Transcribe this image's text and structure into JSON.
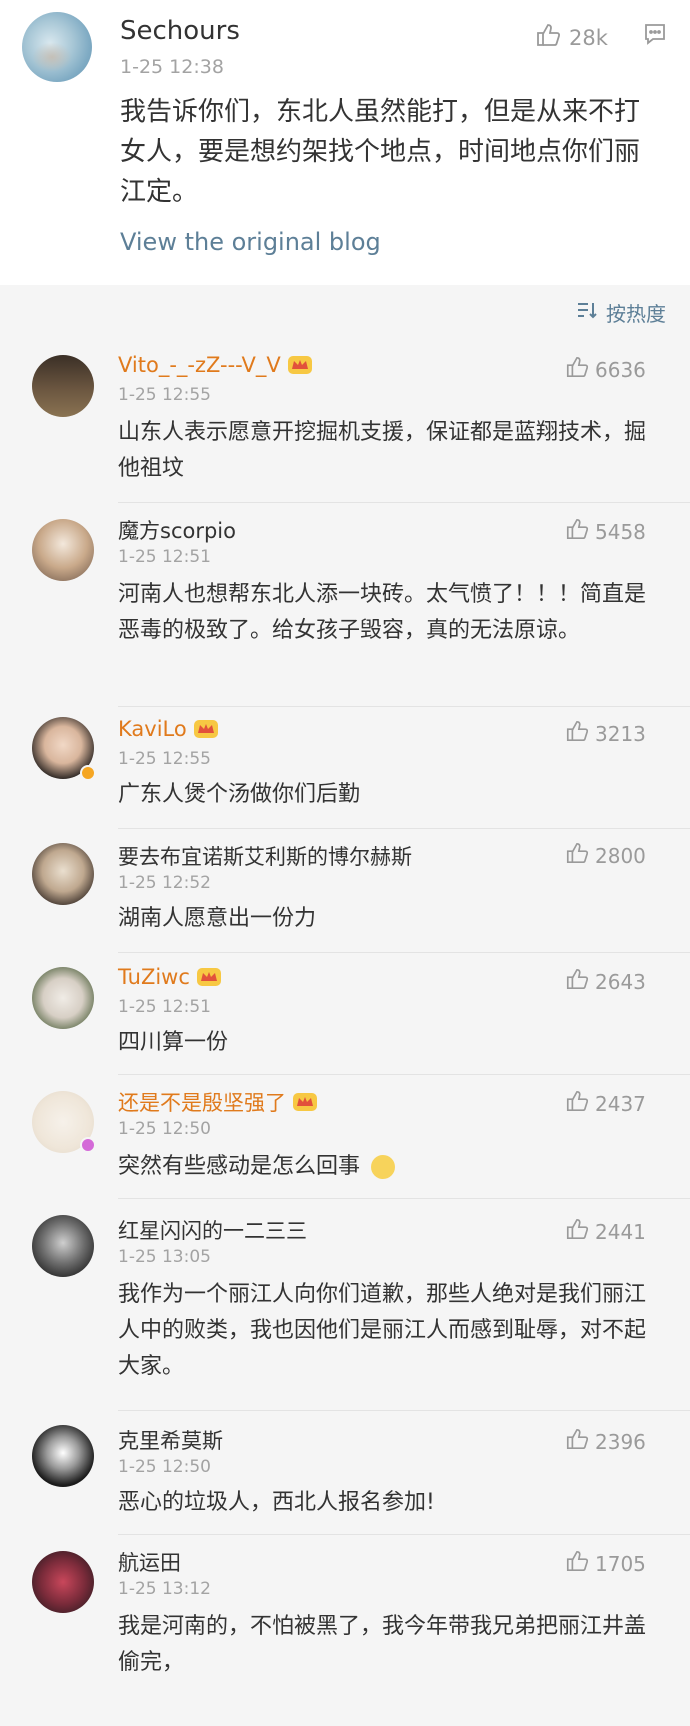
{
  "blog": {
    "author": "Sechours",
    "time": "1-25 12:38",
    "likes": "28k",
    "body": "我告诉你们，东北人虽然能打，但是从来不打女人，要是想约架找个地点，时间地点你们丽江定。",
    "view_link": "View the original blog"
  },
  "sort": {
    "label": "按热度"
  },
  "comments": [
    {
      "name": "Vito_-_-zZ---V_V",
      "time": "1-25 12:55",
      "likes": "6636",
      "text": "山东人表示愿意开挖掘机支援，保证都是蓝翔技术，掘他祖坟"
    },
    {
      "name": "魔方scorpio",
      "time": "1-25 12:51",
      "likes": "5458",
      "text": "河南人也想帮东北人添一块砖。太气愤了！！！简直是恶毒的极致了。给女孩子毁容，真的无法原谅。"
    },
    {
      "name": "KaviLo",
      "time": "1-25 12:55",
      "likes": "3213",
      "text": "广东人煲个汤做你们后勤"
    },
    {
      "name": "要去布宜诺斯艾利斯的博尔赫斯",
      "time": "1-25 12:52",
      "likes": "2800",
      "text": "湖南人愿意出一份力"
    },
    {
      "name": "TuZiwc",
      "time": "1-25 12:51",
      "likes": "2643",
      "text": "四川算一份"
    },
    {
      "name": "还是不是殷坚强了",
      "time": "1-25 12:50",
      "likes": "2437",
      "text": "突然有些感动是怎么回事"
    },
    {
      "name": "红星闪闪的一二三三",
      "time": "1-25 13:05",
      "likes": "2441",
      "text": "我作为一个丽江人向你们道歉，那些人绝对是我们丽江人中的败类，我也因他们是丽江人而感到耻辱，对不起大家。"
    },
    {
      "name": "克里希莫斯",
      "time": "1-25 12:50",
      "likes": "2396",
      "text": "恶心的垃圾人，西北人报名参加!"
    },
    {
      "name": "航运田",
      "time": "1-25 13:12",
      "likes": "1705",
      "text": "我是河南的，不怕被黑了，我今年带我兄弟把丽江井盖偷完，"
    }
  ],
  "colors": {
    "link": "#5d7f97",
    "vip_name": "#e07a1c",
    "meta": "#a3a3a3"
  }
}
